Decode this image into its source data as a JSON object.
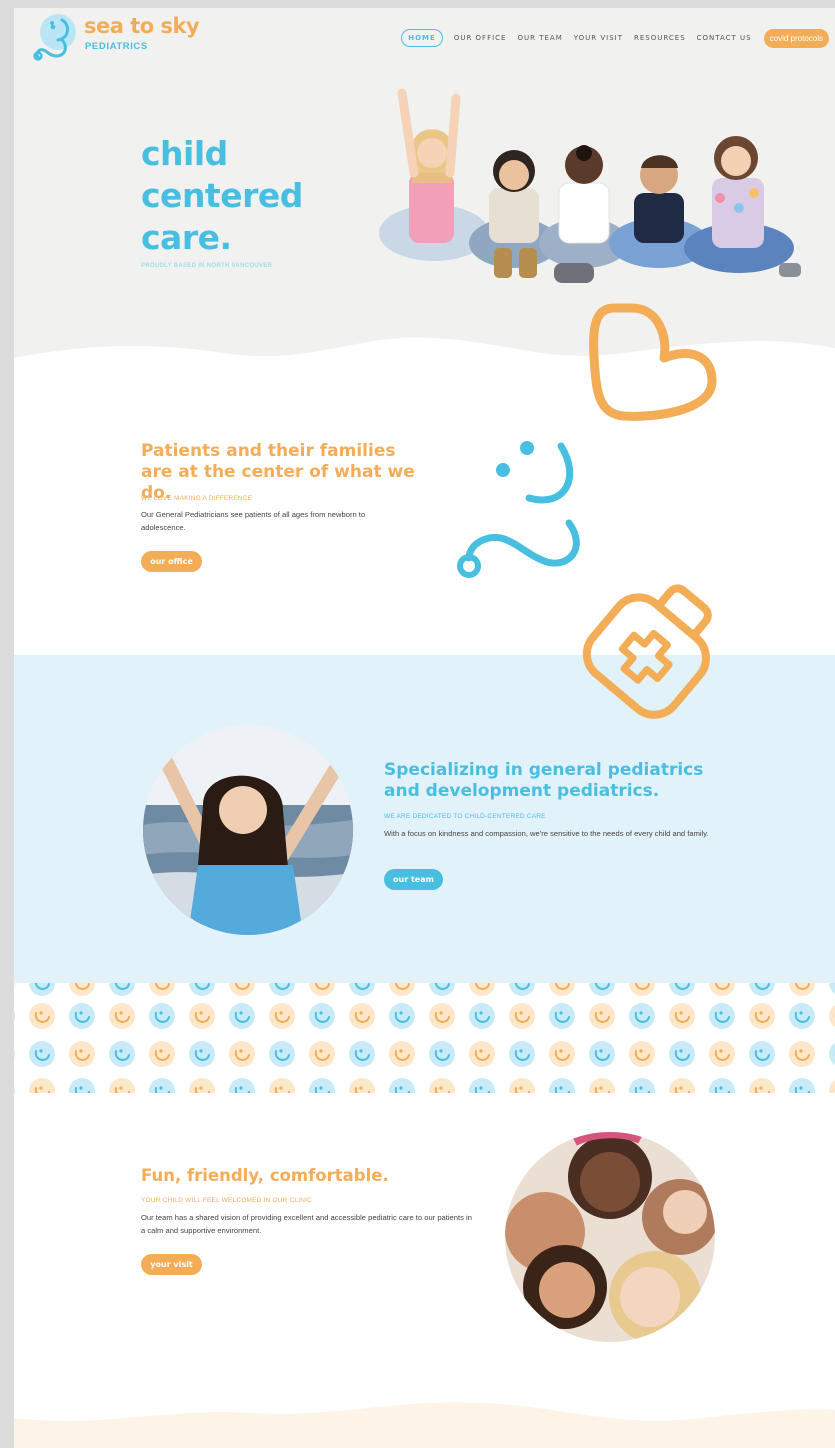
{
  "brand": {
    "name": "sea to sky",
    "subtitle": "PEDIATRICS",
    "colors": {
      "orange": "#f4ad57",
      "blue": "#48bfe0",
      "light_blue_band": "#e2f2fa",
      "hero_bg": "#f1f1f0"
    }
  },
  "nav": {
    "items": [
      "HOME",
      "OUR OFFICE",
      "OUR TEAM",
      "YOUR VISIT",
      "RESOURCES",
      "CONTACT US"
    ],
    "active": "HOME",
    "cta": "covid protocols"
  },
  "hero": {
    "title": "child\ncentered\ncare.",
    "subtitle": "PROUDLY BASED IN NORTH VANCOUVER"
  },
  "section_families": {
    "title": "Patients and their families are at the center of what we do.",
    "eyebrow": "WE LOVE MAKING A DIFFERENCE",
    "body": "Our General Pediatricians see patients of all ages from newborn to adolescence.",
    "button": "our office"
  },
  "section_specializing": {
    "title": "Specializing in general pediatrics and development pediatrics.",
    "eyebrow": "WE ARE DEDICATED TO CHILD-CENTERED CARE",
    "body": "With a focus on kindness and compassion, we're sensitive to the needs of every child and family.",
    "button": "our team"
  },
  "section_friendly": {
    "title": "Fun, friendly, comfortable.",
    "eyebrow": "YOUR CHILD WILL FEEL WELCOMED IN OUR CLINIC",
    "body": "Our team has a shared vision of providing excellent and accessible pediatric care to our patients in a calm and supportive environment.",
    "button": "your visit"
  },
  "icons": [
    "logo-stethoscope-smile-icon",
    "heart-outline-icon",
    "stethoscope-smile-icon",
    "medical-kit-icon",
    "smiley-pattern-icon"
  ]
}
